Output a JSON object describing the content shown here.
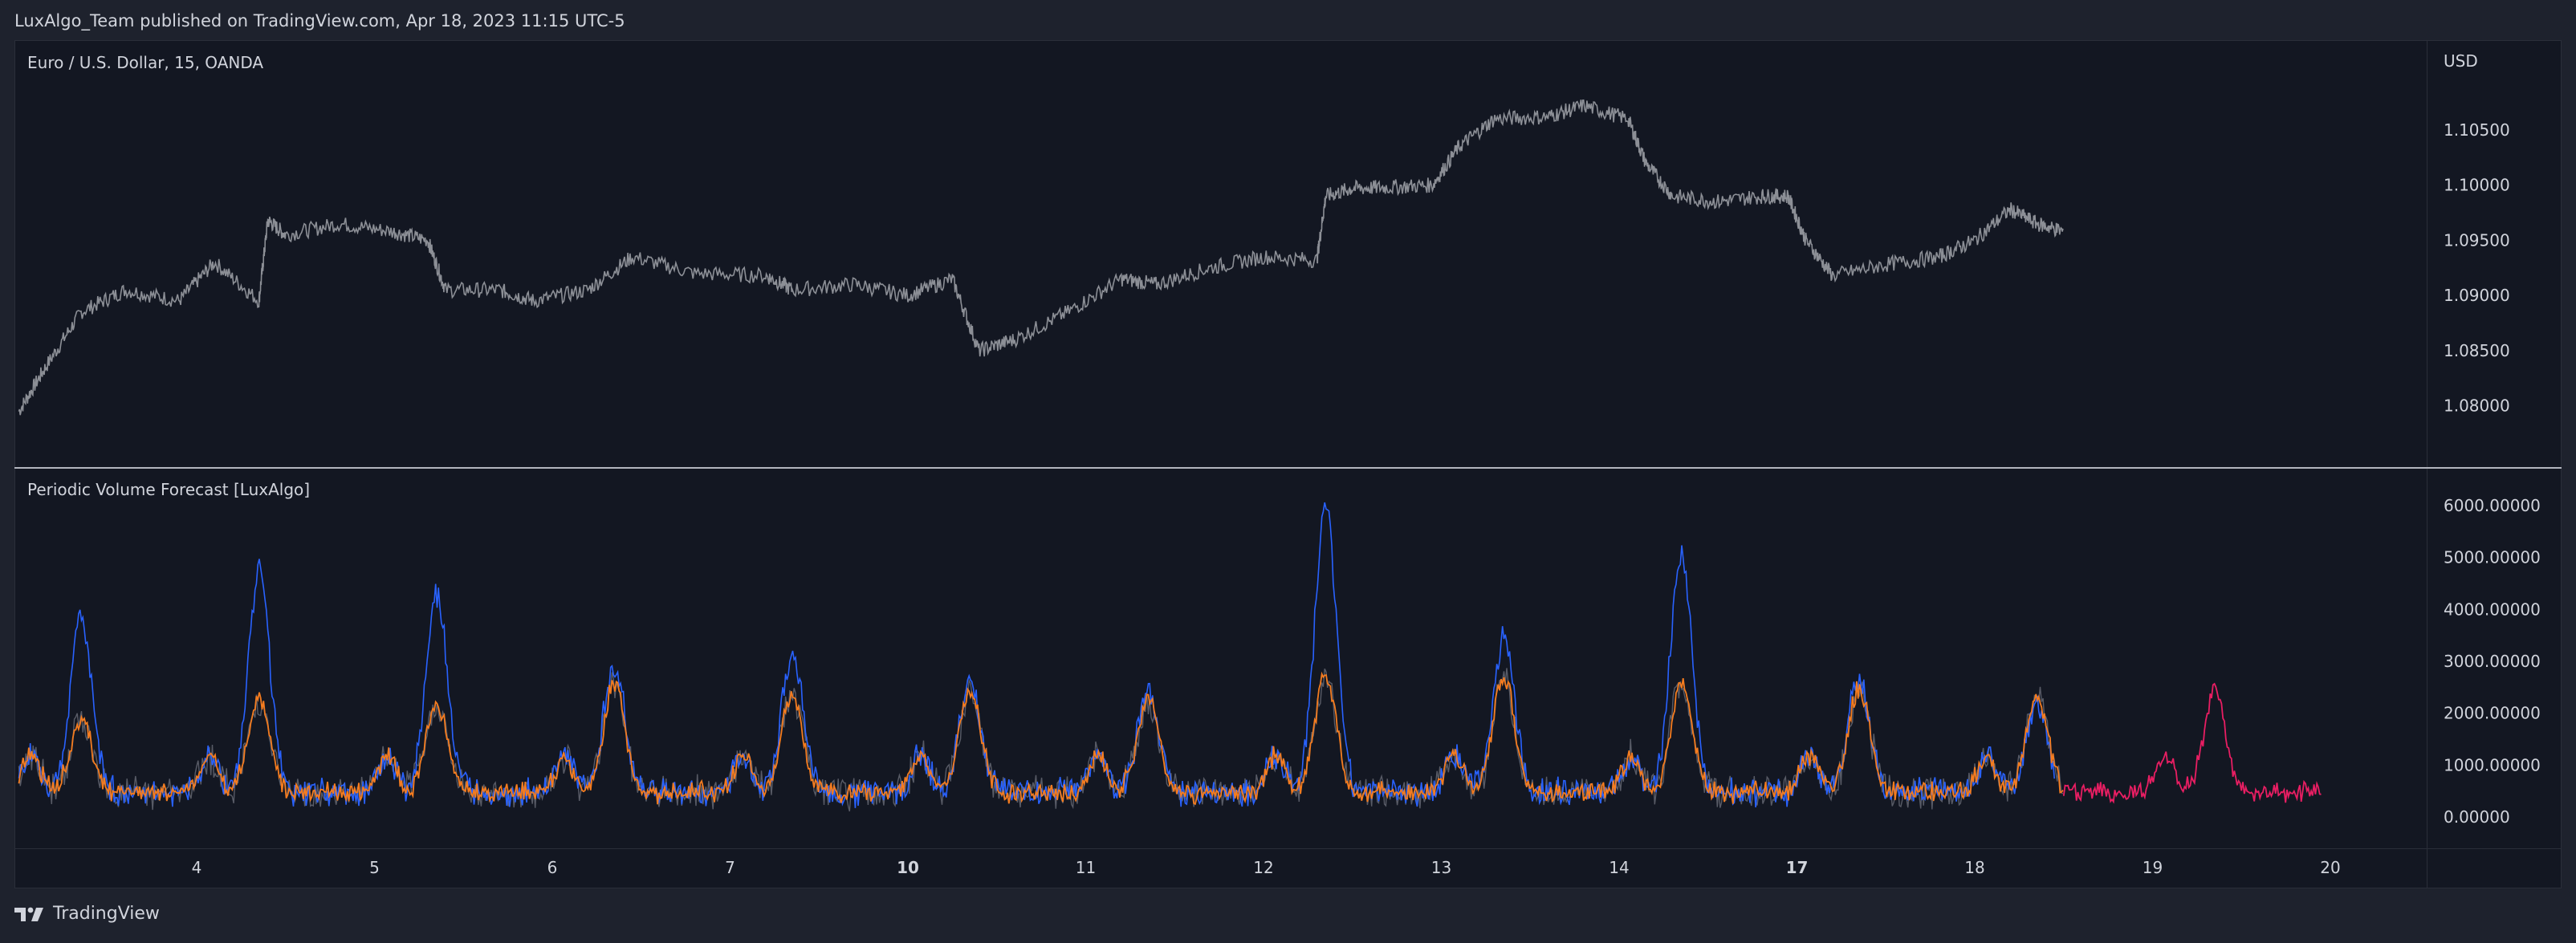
{
  "header": {
    "published_text": "LuxAlgo_Team published on TradingView.com, Apr 18, 2023 11:15 UTC-5"
  },
  "colors": {
    "background": "#1e222d",
    "pane_background": "#131722",
    "price_line": "#8c8f96",
    "volume_blue": "#2962ff",
    "forecast_orange": "#f57c1f",
    "forecast_pink": "#e91e63",
    "volume_gray": "#6a6d78"
  },
  "footer": {
    "brand_text": "TradingView",
    "logo_icon": "tradingview-logo-icon"
  },
  "chart_data": [
    {
      "type": "line",
      "title": "Euro / U.S. Dollar, 15, OANDA",
      "currency_label": "USD",
      "yticks": [
        "1.10500",
        "1.10000",
        "1.09500",
        "1.09000",
        "1.08500",
        "1.08000"
      ],
      "ylim": [
        1.0775,
        1.1095
      ],
      "x_tick_labels": [
        "4",
        "5",
        "6",
        "7",
        "10",
        "11",
        "12",
        "13",
        "14",
        "17",
        "18",
        "19",
        "20"
      ],
      "x_tick_bold": [
        "10",
        "17"
      ],
      "series": [
        {
          "values_by_day": [
            [
              3.0,
              1.0795
            ],
            [
              3.15,
              1.0835
            ],
            [
              3.35,
              1.0885
            ],
            [
              3.6,
              1.0905
            ],
            [
              3.9,
              1.0895
            ],
            [
              4.1,
              1.093
            ],
            [
              4.35,
              1.0895
            ],
            [
              4.4,
              1.0968
            ],
            [
              4.5,
              1.0955
            ],
            [
              4.8,
              1.0965
            ],
            [
              5.1,
              1.0958
            ],
            [
              5.3,
              1.095
            ],
            [
              5.4,
              1.0905
            ],
            [
              5.7,
              1.0905
            ],
            [
              5.9,
              1.0895
            ],
            [
              6.2,
              1.0905
            ],
            [
              6.45,
              1.0935
            ],
            [
              6.8,
              1.092
            ],
            [
              7.2,
              1.0918
            ],
            [
              7.35,
              1.0905
            ],
            [
              7.7,
              1.091
            ],
            [
              8.0,
              1.09
            ],
            [
              8.25,
              1.0915
            ],
            [
              8.4,
              1.085
            ],
            [
              8.6,
              1.086
            ],
            [
              8.9,
              1.0885
            ],
            [
              9.2,
              1.0915
            ],
            [
              9.4,
              1.091
            ],
            [
              9.7,
              1.0925
            ],
            [
              10.0,
              1.0935
            ],
            [
              10.3,
              1.0932
            ],
            [
              10.35,
              1.099
            ],
            [
              10.5,
              1.0997
            ],
            [
              10.7,
              1.0998
            ],
            [
              10.95,
              1.1
            ],
            [
              11.1,
              1.1035
            ],
            [
              11.3,
              1.106
            ],
            [
              11.6,
              1.1062
            ],
            [
              11.8,
              1.1072
            ],
            [
              12.05,
              1.106
            ],
            [
              12.15,
              1.102
            ],
            [
              12.3,
              1.099
            ],
            [
              12.55,
              1.0985
            ],
            [
              12.8,
              1.099
            ],
            [
              12.95,
              1.099
            ],
            [
              13.05,
              1.095
            ],
            [
              13.2,
              1.0918
            ],
            [
              13.5,
              1.0928
            ],
            [
              13.8,
              1.0935
            ],
            [
              14.0,
              1.095
            ],
            [
              14.2,
              1.0978
            ],
            [
              14.35,
              1.0965
            ],
            [
              14.5,
              1.0958
            ]
          ]
        }
      ]
    },
    {
      "type": "line",
      "title": "Periodic Volume Forecast [LuxAlgo]",
      "yticks": [
        "6000.00000",
        "5000.00000",
        "4000.00000",
        "3000.00000",
        "2000.00000",
        "1000.00000",
        "0.00000"
      ],
      "ylim": [
        0,
        6000
      ],
      "x_tick_labels": [
        "4",
        "5",
        "6",
        "7",
        "10",
        "11",
        "12",
        "13",
        "14",
        "17",
        "18",
        "19",
        "20"
      ],
      "peaks_by_day": [
        {
          "day": 3.35,
          "volume": 3950,
          "forecast": 1900
        },
        {
          "day": 4.35,
          "volume": 4750,
          "forecast": 2300
        },
        {
          "day": 5.35,
          "volume": 4300,
          "forecast": 2200
        },
        {
          "day": 6.35,
          "volume": 3000,
          "forecast": 2600
        },
        {
          "day": 7.35,
          "volume": 3200,
          "forecast": 2400
        },
        {
          "day": 8.35,
          "volume": 2600,
          "forecast": 2500
        },
        {
          "day": 9.35,
          "volume": 2400,
          "forecast": 2300
        },
        {
          "day": 10.35,
          "volume": 6000,
          "forecast": 2800
        },
        {
          "day": 11.35,
          "volume": 3500,
          "forecast": 2700
        },
        {
          "day": 12.35,
          "volume": 5100,
          "forecast": 2600
        },
        {
          "day": 13.35,
          "volume": 2700,
          "forecast": 2500
        },
        {
          "day": 14.35,
          "volume": 2200,
          "forecast": 2400
        },
        {
          "day": 15.35,
          "volume": null,
          "forecast": 2500
        }
      ],
      "series": [
        {
          "name": "",
          "color": "#2962ff",
          "role": "volume"
        },
        {
          "name": "",
          "color": "#f57c1f",
          "role": "forecast"
        },
        {
          "name": "",
          "color": "#e91e63",
          "role": "forecast-future"
        }
      ]
    }
  ]
}
